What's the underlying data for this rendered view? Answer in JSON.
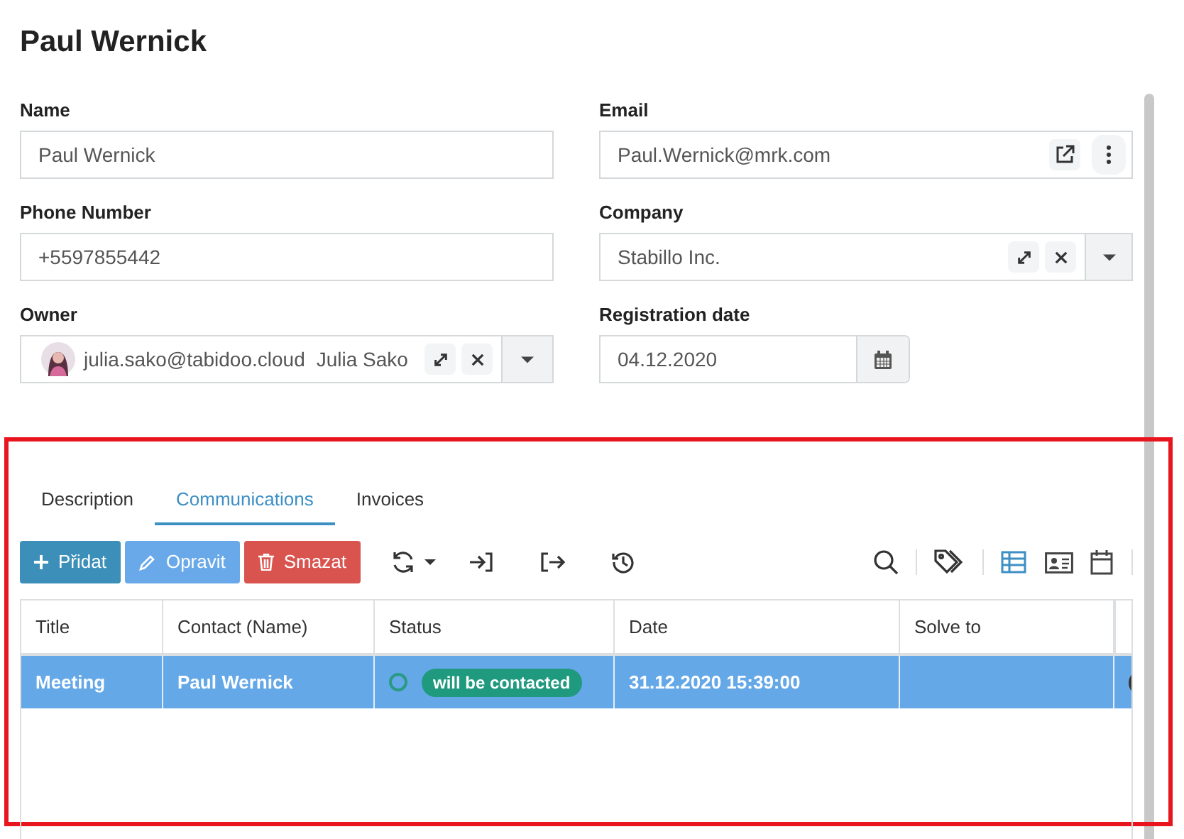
{
  "title": "Paul Wernick",
  "fields": [
    {
      "kind": "text",
      "label": "Name",
      "value": "Paul Wernick"
    },
    {
      "kind": "email",
      "label": "Email",
      "value": "Paul.Wernick@mrk.com"
    },
    {
      "kind": "text",
      "label": "Phone Number",
      "value": "+5597855442"
    },
    {
      "kind": "lookup",
      "label": "Company",
      "value": "Stabillo Inc."
    },
    {
      "kind": "user",
      "label": "Owner",
      "value": "julia.sako@tabidoo.cloud",
      "user_name": "Julia Sako"
    },
    {
      "kind": "date",
      "label": "Registration date",
      "value": "04.12.2020"
    }
  ],
  "tabs": [
    {
      "label": "Description",
      "selected": false
    },
    {
      "label": "Communications",
      "selected": true
    },
    {
      "label": "Invoices",
      "selected": false
    }
  ],
  "toolbar": {
    "buttons": [
      {
        "kind": "add",
        "label": "Přidat"
      },
      {
        "kind": "edit",
        "label": "Opravit"
      },
      {
        "kind": "delete",
        "label": "Smazat"
      }
    ]
  },
  "table": {
    "columns": [
      "Title",
      "Contact (Name)",
      "Status",
      "Date",
      "Solve to"
    ],
    "rows": [
      {
        "selected": true,
        "title": "Meeting",
        "contact": "Paul Wernick",
        "status": "will be contacted",
        "date": "31.12.2020 15:39:00",
        "solve_to": ""
      }
    ]
  }
}
